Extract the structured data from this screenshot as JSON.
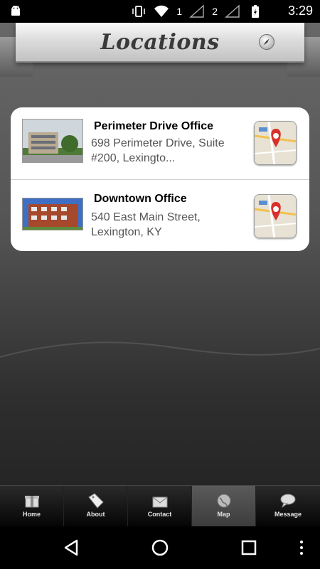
{
  "status_bar": {
    "sim1_label": "1",
    "sim2_label": "2",
    "time": "3:29",
    "icons": [
      "android-icon",
      "vibrate-icon",
      "wifi-icon",
      "signal-icon",
      "battery-icon"
    ]
  },
  "header": {
    "title": "Locations",
    "compass_icon": "compass-icon"
  },
  "locations": [
    {
      "name": "Perimeter Drive Office",
      "address": "698 Perimeter Drive, Suite\n#200, Lexingto...",
      "map_icon": "map-pin-icon"
    },
    {
      "name": "Downtown Office",
      "address": " 540 East Main Street,\nLexington, KY",
      "map_icon": "map-pin-icon"
    }
  ],
  "tab_bar": {
    "tabs": [
      {
        "label": "Home",
        "icon": "home-icon"
      },
      {
        "label": "About",
        "icon": "tag-icon"
      },
      {
        "label": "Contact",
        "icon": "envelope-icon"
      },
      {
        "label": "Map",
        "icon": "globe-icon"
      },
      {
        "label": "Message",
        "icon": "chat-icon"
      }
    ],
    "active": "Map"
  },
  "nav_bar": {
    "icons": [
      "back-icon",
      "home-circle-icon",
      "recents-icon",
      "more-icon"
    ]
  },
  "colors": {
    "card_bg": "#ffffff",
    "title_text": "#3a3a3a",
    "pin_red": "#d9302c",
    "active_tab": "#4a4a4a"
  }
}
